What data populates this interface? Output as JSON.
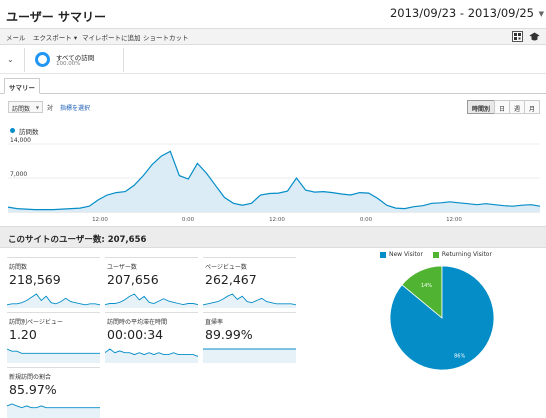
{
  "header": {
    "title": "ユーザー サマリー",
    "date_range": "2013/09/23 - 2013/09/25"
  },
  "toolbar": {
    "items": [
      "メール",
      "エクスポート ▾",
      "マイレポートに追加",
      "ショートカット"
    ],
    "icons": [
      "qr-icon",
      "graduation-cap-icon"
    ]
  },
  "segment": {
    "name": "すべての訪問",
    "percent": "100.00%",
    "accent": "#2196f3"
  },
  "tabs": {
    "summary": "サマリー"
  },
  "controls": {
    "metric": "訪問数",
    "vs": "対",
    "pick_metric": "指標を選択",
    "granularity": [
      "時間別",
      "日",
      "週",
      "月"
    ],
    "active_granularity": "時間別"
  },
  "chart_data": {
    "type": "area",
    "legend": [
      "訪問数"
    ],
    "y_ticks": [
      "14,000",
      "7,000"
    ],
    "ylim": [
      0,
      14000
    ],
    "x_ticks": [
      "12:00",
      "0:00",
      "12:00",
      "0:00",
      "12:00"
    ],
    "series": [
      {
        "name": "訪問数",
        "color": "#058dc7",
        "values": [
          1000,
          700,
          600,
          500,
          500,
          500,
          600,
          700,
          800,
          1200,
          2500,
          3500,
          4000,
          4200,
          5500,
          7500,
          9800,
          11500,
          12500,
          7500,
          6800,
          10000,
          8000,
          5500,
          3000,
          1800,
          1400,
          1800,
          3500,
          3800,
          3900,
          4300,
          7000,
          4500,
          4100,
          4200,
          4000,
          3700,
          3500,
          4000,
          3900,
          2800,
          1400,
          800,
          700,
          1100,
          1300,
          1800,
          1900,
          2100,
          1900,
          1700,
          1500,
          1700,
          1500,
          1300,
          1200,
          1400,
          1500,
          1200
        ]
      }
    ]
  },
  "section": {
    "title": "このサイトのユーザー数: 207,656"
  },
  "kpis": [
    {
      "label": "訪問数",
      "value": "218,569",
      "spark": [
        2,
        3,
        3,
        4,
        6,
        9,
        12,
        6,
        10,
        4,
        3,
        5,
        8,
        5,
        4,
        3,
        2,
        3,
        3,
        2
      ]
    },
    {
      "label": "ユーザー数",
      "value": "207,656",
      "spark": [
        2,
        3,
        3,
        4,
        6,
        9,
        11,
        6,
        9,
        4,
        3,
        5,
        7,
        5,
        4,
        3,
        2,
        3,
        3,
        2
      ]
    },
    {
      "label": "ページビュー数",
      "value": "262,467",
      "spark": [
        2,
        3,
        4,
        5,
        7,
        10,
        12,
        7,
        10,
        5,
        4,
        6,
        8,
        5,
        4,
        3,
        3,
        3,
        3,
        2
      ]
    },
    {
      "label": "訪問別ページビュー",
      "value": "1.20",
      "spark": [
        6,
        5,
        5,
        4,
        4,
        4,
        4,
        4,
        4,
        4,
        4,
        4,
        4,
        4,
        4,
        4,
        4,
        4,
        4,
        4
      ]
    },
    {
      "label": "訪問時の平均滞在時間",
      "value": "00:00:34",
      "spark": [
        5,
        7,
        5,
        6,
        5,
        5,
        4,
        5,
        4,
        5,
        4,
        5,
        4,
        4,
        5,
        4,
        4,
        4,
        4,
        3
      ]
    },
    {
      "label": "直帰率",
      "value": "89.99%",
      "spark": [
        5,
        5,
        5,
        5,
        5,
        5,
        5,
        5,
        5,
        5,
        5,
        5,
        5,
        5,
        5,
        5,
        5,
        5,
        5,
        5
      ]
    },
    {
      "label": "新規訪問の割合",
      "value": "85.97%",
      "spark": [
        6,
        7,
        6,
        5,
        6,
        5,
        5,
        6,
        5,
        5,
        5,
        5,
        5,
        5,
        5,
        5,
        5,
        5,
        5,
        5
      ]
    }
  ],
  "pie": {
    "legend": [
      {
        "name": "New Visitor",
        "color": "#058dc7"
      },
      {
        "name": "Returning Visitor",
        "color": "#50b432"
      }
    ],
    "slices": [
      {
        "name": "New Visitor",
        "value": 86,
        "label": "86%",
        "color": "#058dc7"
      },
      {
        "name": "Returning Visitor",
        "value": 14,
        "label": "14%",
        "color": "#50b432"
      }
    ]
  }
}
